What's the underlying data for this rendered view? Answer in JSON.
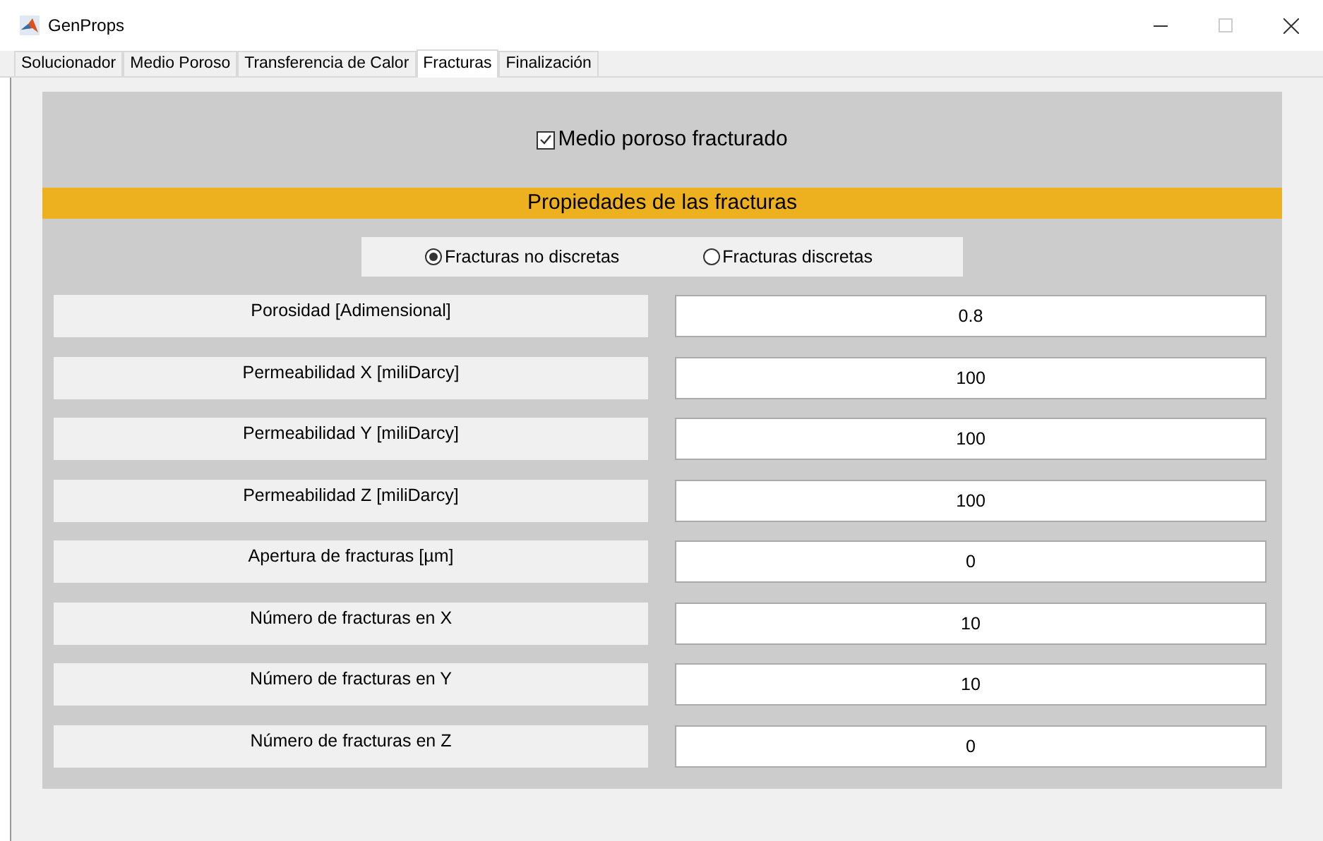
{
  "window": {
    "title": "GenProps"
  },
  "tabs": [
    {
      "label": "Solucionador",
      "selected": false
    },
    {
      "label": "Medio Poroso",
      "selected": false
    },
    {
      "label": "Transferencia de Calor",
      "selected": false
    },
    {
      "label": "Fracturas",
      "selected": true
    },
    {
      "label": "Finalización",
      "selected": false
    }
  ],
  "fractured_checkbox": {
    "label": "Medio poroso fracturado",
    "checked": true
  },
  "section_title": "Propiedades de las fracturas",
  "fracture_type": [
    {
      "label": "Fracturas no discretas",
      "selected": true
    },
    {
      "label": "Fracturas discretas",
      "selected": false
    }
  ],
  "fields": [
    {
      "label": "Porosidad [Adimensional]",
      "value": "0.8"
    },
    {
      "label": "Permeabilidad X [miliDarcy]",
      "value": "100"
    },
    {
      "label": "Permeabilidad Y [miliDarcy]",
      "value": "100"
    },
    {
      "label": "Permeabilidad Z [miliDarcy]",
      "value": "100"
    },
    {
      "label": "Apertura de fracturas [µm]",
      "value": "0"
    },
    {
      "label": "Número de fracturas en X",
      "value": "10"
    },
    {
      "label": "Número de fracturas en Y",
      "value": "10"
    },
    {
      "label": "Número de fracturas en Z",
      "value": "0"
    }
  ]
}
